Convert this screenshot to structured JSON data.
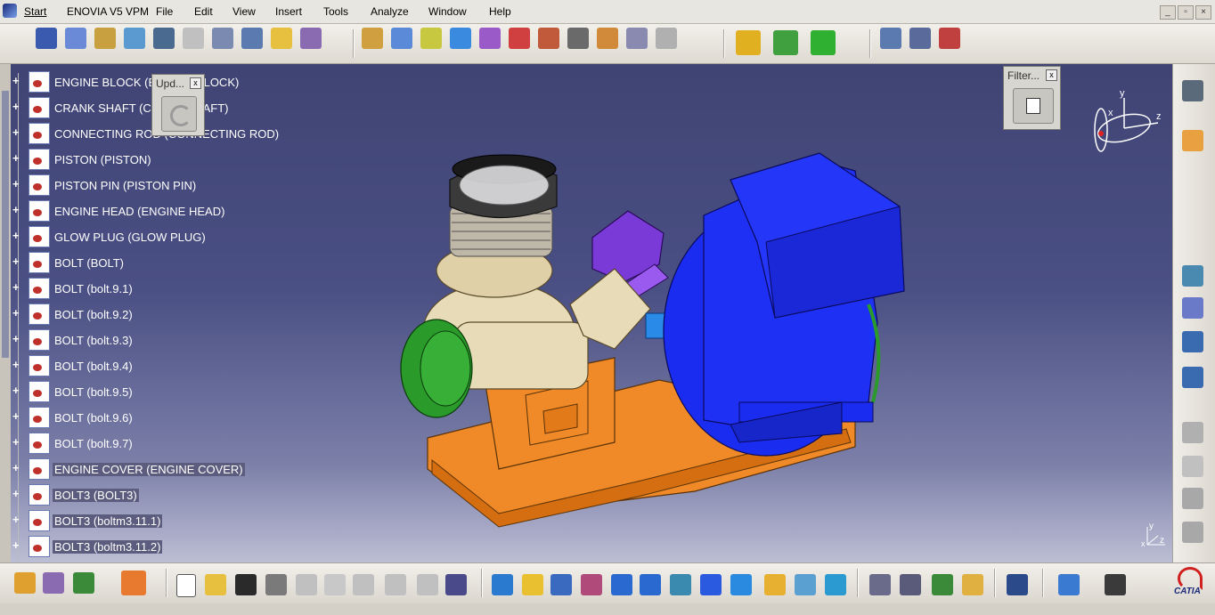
{
  "menubar": {
    "start": "Start",
    "items": [
      "ENOVIA V5 VPM",
      "File",
      "Edit",
      "View",
      "Insert",
      "Tools",
      "Analyze",
      "Window",
      "Help"
    ]
  },
  "window_controls": {
    "minimize": "_",
    "restore": "▫",
    "close": "×"
  },
  "tree": {
    "items": [
      {
        "label": "ENGINE BLOCK (ENGINE BLOCK)",
        "selected": false
      },
      {
        "label": "CRANK SHAFT (CRANK SHAFT)",
        "selected": false
      },
      {
        "label": "CONNECTING ROD (CONNECTING ROD)",
        "selected": false
      },
      {
        "label": "PISTON (PISTON)",
        "selected": false
      },
      {
        "label": "PISTON PIN (PISTON PIN)",
        "selected": false
      },
      {
        "label": "ENGINE HEAD (ENGINE HEAD)",
        "selected": false
      },
      {
        "label": "GLOW PLUG (GLOW PLUG)",
        "selected": false
      },
      {
        "label": "BOLT (BOLT)",
        "selected": false
      },
      {
        "label": "BOLT (bolt.9.1)",
        "selected": false
      },
      {
        "label": "BOLT (bolt.9.2)",
        "selected": false
      },
      {
        "label": "BOLT (bolt.9.3)",
        "selected": false
      },
      {
        "label": "BOLT (bolt.9.4)",
        "selected": false
      },
      {
        "label": "BOLT (bolt.9.5)",
        "selected": false
      },
      {
        "label": "BOLT (bolt.9.6)",
        "selected": false
      },
      {
        "label": "BOLT (bolt.9.7)",
        "selected": false
      },
      {
        "label": "ENGINE COVER (ENGINE COVER)",
        "selected": true
      },
      {
        "label": "BOLT3 (BOLT3)",
        "selected": true
      },
      {
        "label": "BOLT3 (boltm3.11.1)",
        "selected": true
      },
      {
        "label": "BOLT3 (boltm3.11.2)",
        "selected": true
      }
    ]
  },
  "update_toolbar": {
    "title": "Upd...",
    "close": "x"
  },
  "filter_toolbar": {
    "title": "Filter...",
    "close": "x"
  },
  "compass": {
    "x": "x",
    "y": "y",
    "z": "z"
  },
  "axis_indicator": {
    "x": "x",
    "y": "y",
    "z": "z"
  },
  "brand": {
    "logo_text": "CATIA"
  },
  "colors": {
    "viewport_top": "#404474",
    "engine_cover": "#1a2cf0",
    "base_frame": "#f08a28",
    "crankcase": "#e8dcb8",
    "flywheel": "#2a9a2a",
    "con_rod_part": "#7a3ad8"
  }
}
